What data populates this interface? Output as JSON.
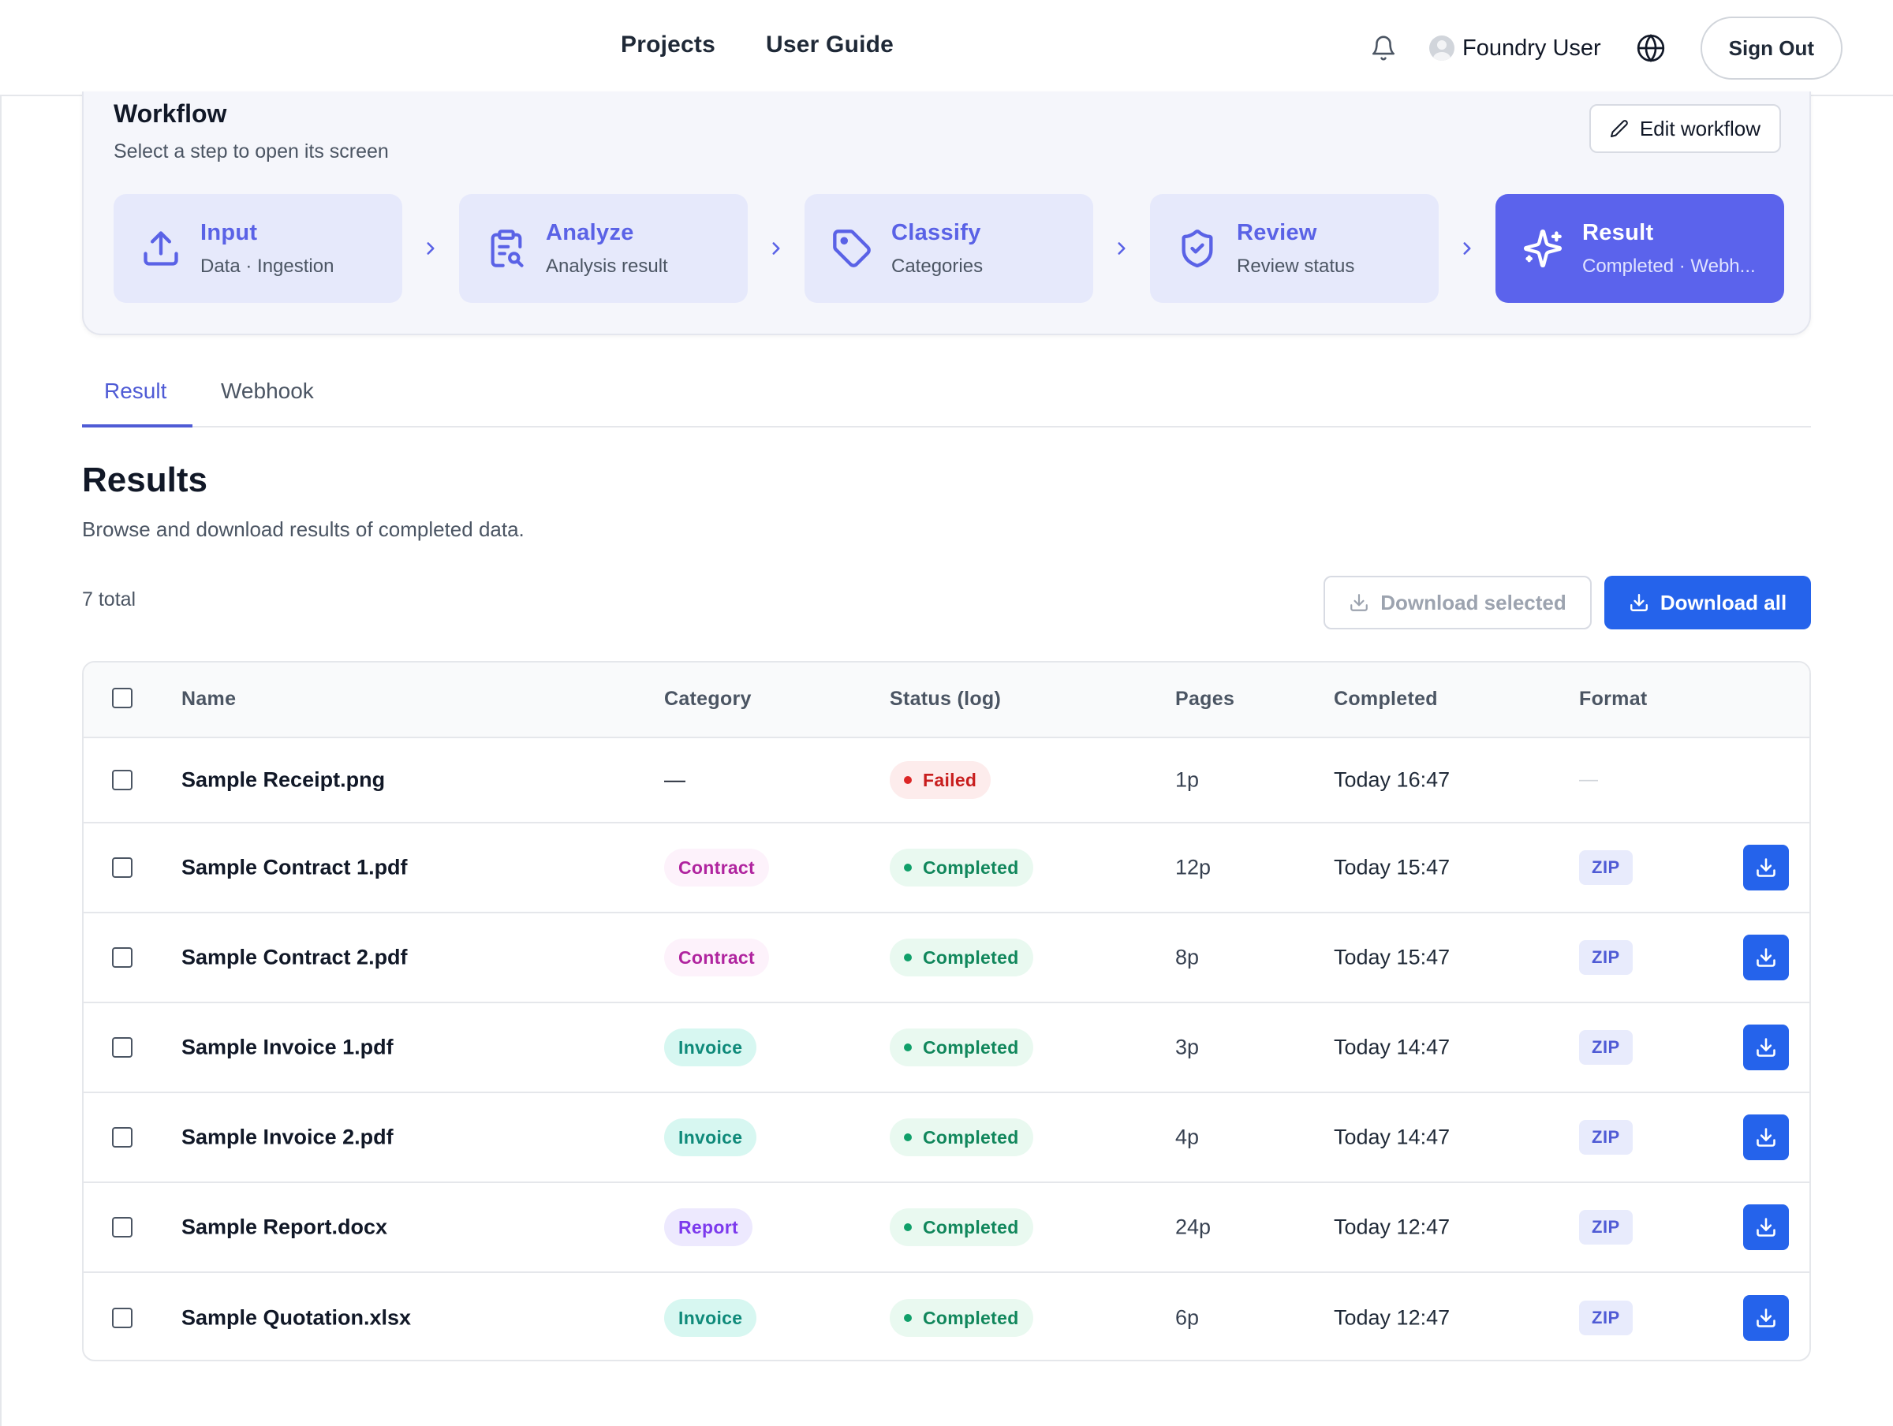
{
  "nav": {
    "links": [
      "Projects",
      "User Guide"
    ],
    "user_name": "Foundry User",
    "sign_out": "Sign Out"
  },
  "workflow": {
    "title": "Workflow",
    "subtitle": "Select a step to open its screen",
    "edit_label": "Edit workflow",
    "steps": [
      {
        "title": "Input",
        "sub": "Data · Ingestion",
        "icon": "upload-icon"
      },
      {
        "title": "Analyze",
        "sub": "Analysis result",
        "icon": "clipboard-search-icon"
      },
      {
        "title": "Classify",
        "sub": "Categories",
        "icon": "tag-icon"
      },
      {
        "title": "Review",
        "sub": "Review status",
        "icon": "shield-check-icon"
      },
      {
        "title": "Result",
        "sub": "Completed · Webh...",
        "icon": "sparkles-icon",
        "active": true
      }
    ]
  },
  "tabs": {
    "result": "Result",
    "webhook": "Webhook"
  },
  "results": {
    "title": "Results",
    "description": "Browse and download results of completed data.",
    "total": "7 total",
    "download_selected": "Download selected",
    "download_all": "Download all"
  },
  "table": {
    "headers": {
      "name": "Name",
      "category": "Category",
      "status": "Status (log)",
      "pages": "Pages",
      "completed": "Completed",
      "format": "Format"
    },
    "rows": [
      {
        "name": "Sample Receipt.png",
        "category": "—",
        "status": "Failed",
        "pages": "1p",
        "completed": "Today 16:47",
        "format": "—"
      },
      {
        "name": "Sample Contract 1.pdf",
        "category": "Contract",
        "status": "Completed",
        "pages": "12p",
        "completed": "Today 15:47",
        "format": "ZIP"
      },
      {
        "name": "Sample Contract 2.pdf",
        "category": "Contract",
        "status": "Completed",
        "pages": "8p",
        "completed": "Today 15:47",
        "format": "ZIP"
      },
      {
        "name": "Sample Invoice 1.pdf",
        "category": "Invoice",
        "status": "Completed",
        "pages": "3p",
        "completed": "Today 14:47",
        "format": "ZIP"
      },
      {
        "name": "Sample Invoice 2.pdf",
        "category": "Invoice",
        "status": "Completed",
        "pages": "4p",
        "completed": "Today 14:47",
        "format": "ZIP"
      },
      {
        "name": "Sample Report.docx",
        "category": "Report",
        "status": "Completed",
        "pages": "24p",
        "completed": "Today 12:47",
        "format": "ZIP"
      },
      {
        "name": "Sample Quotation.xlsx",
        "category": "Invoice",
        "status": "Completed",
        "pages": "6p",
        "completed": "Today 12:47",
        "format": "ZIP"
      }
    ]
  },
  "colors": {
    "accent": "#5b63ec",
    "primary_button": "#2563eb",
    "contract_bg": "#fdf2fb",
    "contract_fg": "#b0249f",
    "invoice_bg": "#d7f7f1",
    "invoice_fg": "#0f8a7a",
    "report_bg": "#ede9fe",
    "report_fg": "#7c3aed",
    "completed_bg": "#e9f9f0",
    "completed_fg": "#11875c",
    "failed_bg": "#fdecec",
    "failed_fg": "#c81e1e"
  }
}
